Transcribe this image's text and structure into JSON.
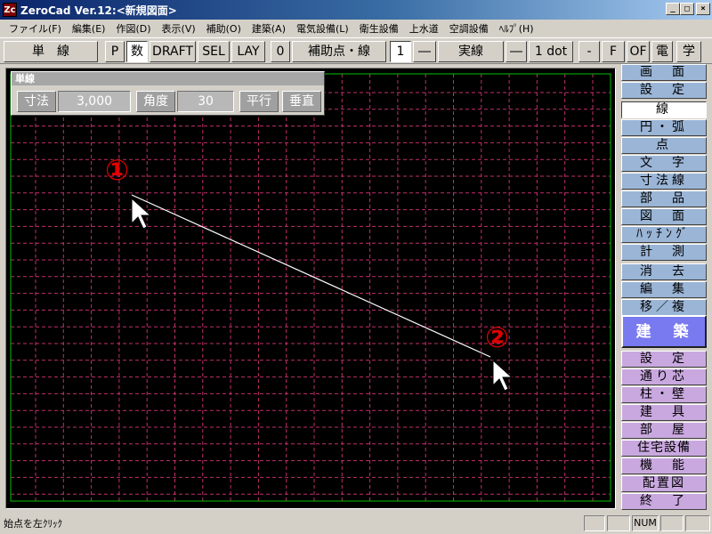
{
  "window": {
    "title": "ZeroCad Ver.12:<新規図面>",
    "icon_label": "Zc",
    "minimize": "_",
    "maximize": "□",
    "close": "×"
  },
  "menu": [
    "ファイル(F)",
    "編集(E)",
    "作図(D)",
    "表示(V)",
    "補助(O)",
    "建築(A)",
    "電気設備(L)",
    "衛生設備",
    "上水道",
    "空調設備",
    "ﾍﾙﾌﾟ(H)"
  ],
  "toolbar": {
    "mode": "単　線",
    "p": "P",
    "num": "数",
    "draft": "DRAFT",
    "sel": "SEL",
    "lay": "LAY",
    "layer_no": "0",
    "aux": "補助点・線",
    "count": "1",
    "dash1": "―",
    "linetype": "実線",
    "dash2": "―",
    "width": "1 dot",
    "minus": "-",
    "f": "F",
    "of": "OF",
    "den": "電",
    "gaku": "学"
  },
  "palette": {
    "caption": "単線",
    "dim_label": "寸法",
    "dim_value": "3,000",
    "angle_label": "角度",
    "angle_value": "30",
    "parallel": "平行",
    "vertical": "垂直"
  },
  "annotations": {
    "start_marker": "①",
    "end_marker": "②"
  },
  "right_panel": {
    "blue_group": [
      "画　面",
      "設　定"
    ],
    "selected": "線",
    "draw_group": [
      "円・弧",
      "点",
      "文　字",
      "寸法線",
      "部　品",
      "図　面",
      "ﾊｯﾁﾝｸﾞ",
      "計　測"
    ],
    "edit_group": [
      "消　去",
      "編　集",
      "移／複"
    ],
    "arch": "建　築",
    "arch_group": [
      "設　定",
      "通り芯",
      "柱・壁",
      "建　具",
      "部　屋",
      "住宅設備",
      "機　能",
      "配置図",
      "終　了"
    ]
  },
  "statusbar": {
    "message": "始点を左ｸﾘｯｸ",
    "num": "NUM"
  },
  "colors": {
    "canvas_bg": "#000000",
    "grid": "#c0306a",
    "frame": "#00c000",
    "line": "#ffffff",
    "marker": "#e00000",
    "blue_btn": "#9ab5d6",
    "purple_btn": "#c9a8df",
    "arch_btn": "#7a7af0"
  }
}
